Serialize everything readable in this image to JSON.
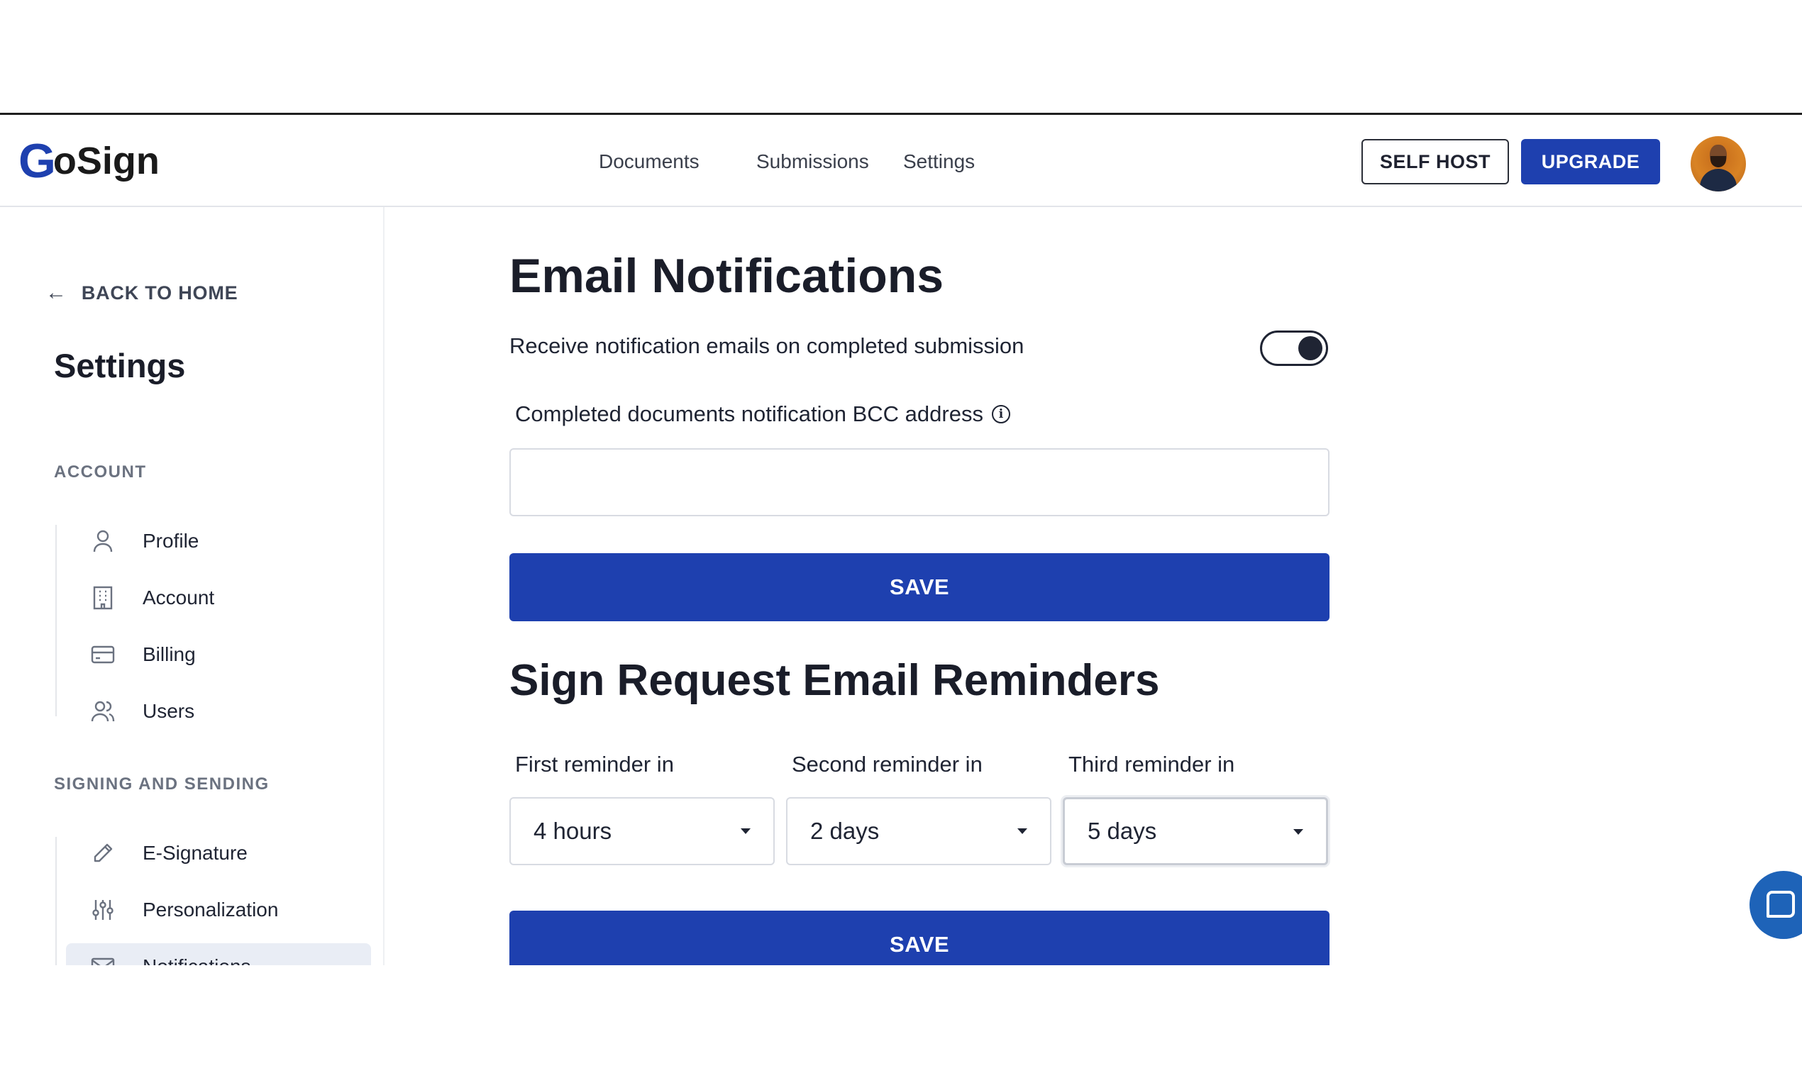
{
  "header": {
    "logo_mark": "G",
    "logo_rest": "oSign",
    "nav": [
      "Documents",
      "Submissions",
      "Settings"
    ],
    "self_host_label": "SELF HOST",
    "upgrade_label": "UPGRADE"
  },
  "sidebar": {
    "back_label": "BACK TO HOME",
    "title": "Settings",
    "sections": [
      {
        "label": "ACCOUNT",
        "items": [
          {
            "label": "Profile",
            "icon": "user-icon"
          },
          {
            "label": "Account",
            "icon": "building-icon"
          },
          {
            "label": "Billing",
            "icon": "credit-card-icon"
          },
          {
            "label": "Users",
            "icon": "users-icon"
          }
        ]
      },
      {
        "label": "SIGNING AND SENDING",
        "items": [
          {
            "label": "E-Signature",
            "icon": "pen-icon"
          },
          {
            "label": "Personalization",
            "icon": "sliders-icon"
          },
          {
            "label": "Notifications",
            "icon": "mail-icon",
            "active": true
          }
        ]
      }
    ]
  },
  "email_notifications": {
    "title": "Email Notifications",
    "toggle_label": "Receive notification emails on completed submission",
    "toggle_on": true,
    "bcc_label": "Completed documents notification BCC address",
    "bcc_value": "",
    "save_label": "SAVE"
  },
  "reminders": {
    "title": "Sign Request Email Reminders",
    "first_label": "First reminder in",
    "first_value": "4 hours",
    "second_label": "Second reminder in",
    "second_value": "2 days",
    "third_label": "Third reminder in",
    "third_value": "5 days",
    "save_label": "SAVE"
  },
  "colors": {
    "accent": "#1e40af",
    "chat": "#1e63b8"
  }
}
